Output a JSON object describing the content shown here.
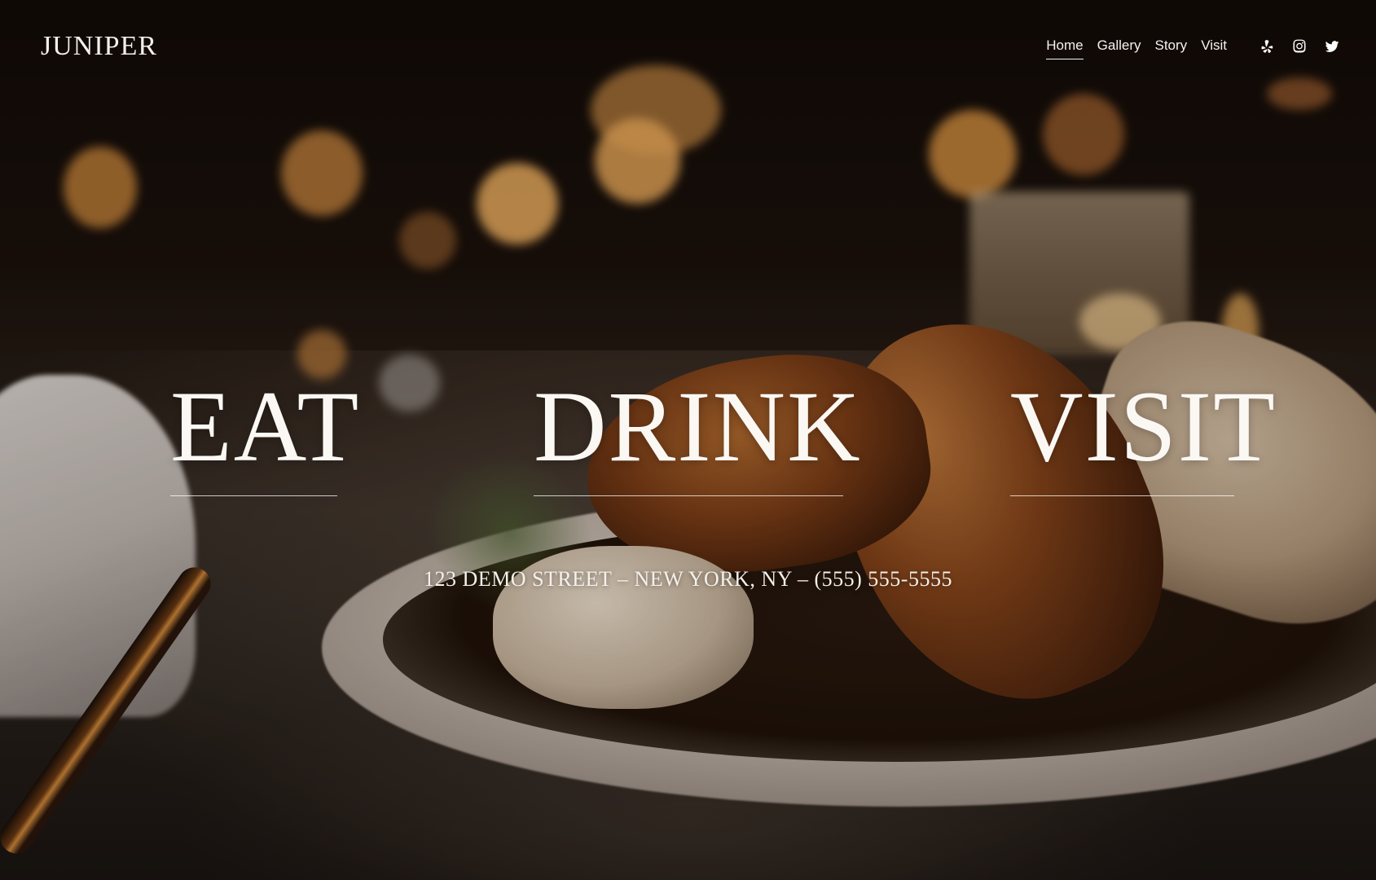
{
  "brand": {
    "logo": "JUNIPER"
  },
  "nav": {
    "items": [
      {
        "label": "Home",
        "active": true
      },
      {
        "label": "Gallery",
        "active": false
      },
      {
        "label": "Story",
        "active": false
      },
      {
        "label": "Visit",
        "active": false
      }
    ]
  },
  "socials": [
    {
      "icon": "yelp-icon"
    },
    {
      "icon": "instagram-icon"
    },
    {
      "icon": "twitter-icon"
    }
  ],
  "hero": {
    "links": [
      "EAT",
      "DRINK",
      "VISIT"
    ],
    "address": "123 DEMO STREET – NEW YORK, NY – (555) 555-5555"
  },
  "colors": {
    "text": "#ffffff",
    "background_dark": "#140c07"
  }
}
